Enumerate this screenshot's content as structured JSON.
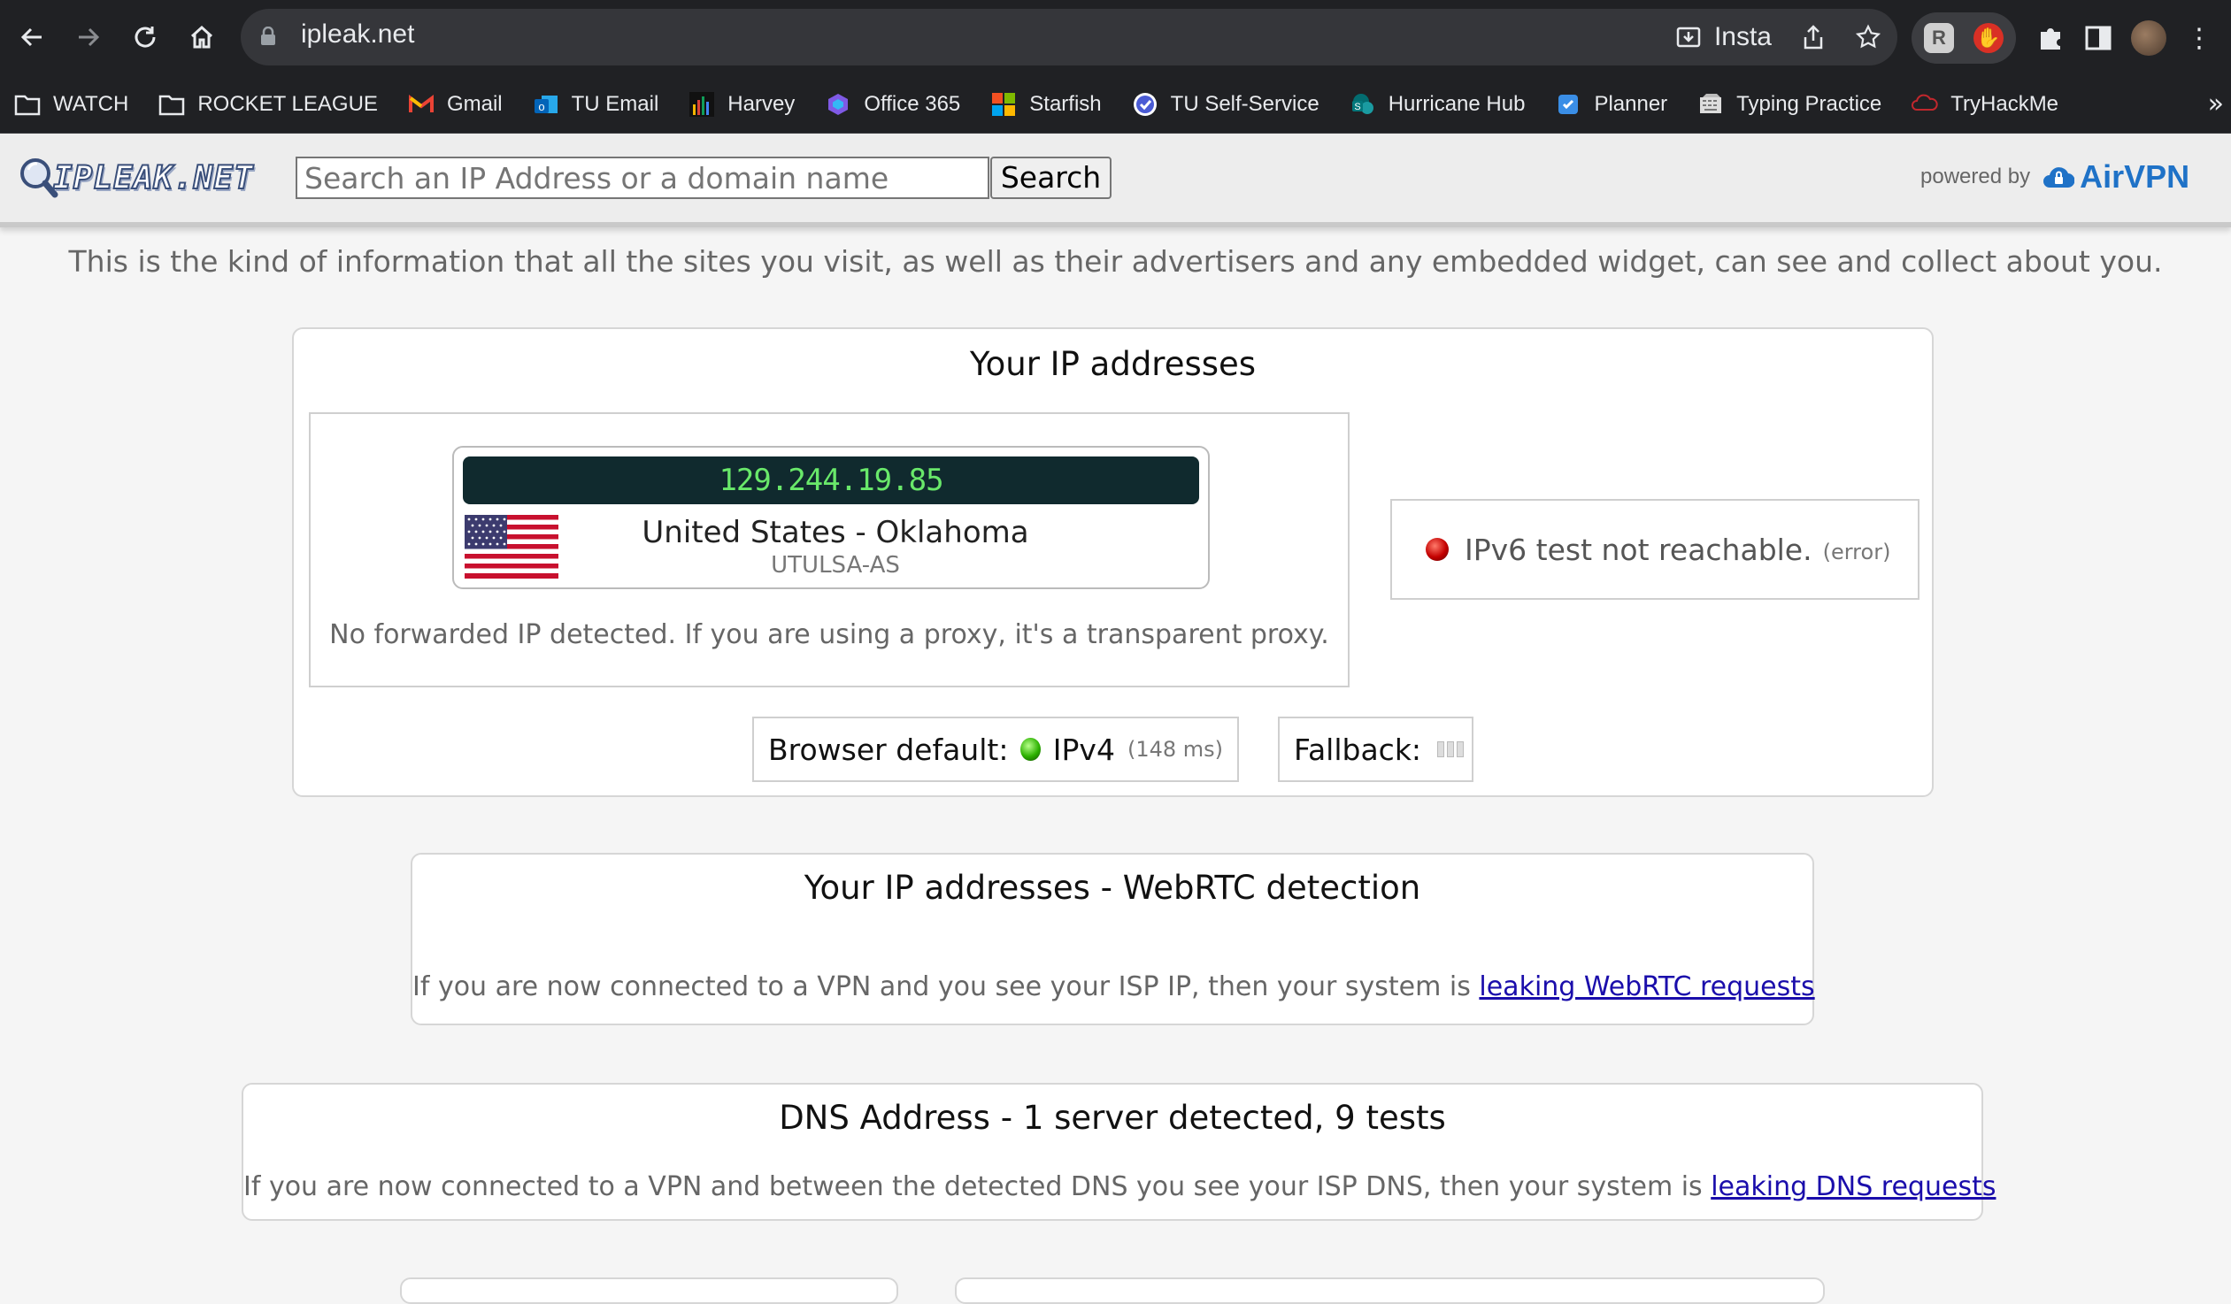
{
  "browser": {
    "url": "ipleak.net",
    "install_label": "Insta",
    "bookmarks": [
      {
        "label": "WATCH",
        "icon": "folder-icon"
      },
      {
        "label": "ROCKET LEAGUE",
        "icon": "folder-icon"
      },
      {
        "label": "Gmail",
        "icon": "gmail-icon"
      },
      {
        "label": "TU Email",
        "icon": "outlook-icon"
      },
      {
        "label": "Harvey",
        "icon": "harvey-icon"
      },
      {
        "label": "Office 365",
        "icon": "office-icon"
      },
      {
        "label": "Starfish",
        "icon": "starfish-icon"
      },
      {
        "label": "TU Self-Service",
        "icon": "self-service-icon"
      },
      {
        "label": "Hurricane Hub",
        "icon": "sharepoint-icon"
      },
      {
        "label": "Planner",
        "icon": "planner-icon"
      },
      {
        "label": "Typing Practice",
        "icon": "typing-icon"
      },
      {
        "label": "TryHackMe",
        "icon": "tryhackme-icon"
      }
    ],
    "more_label": "»"
  },
  "header": {
    "logo_text": "IPLEAK.NET",
    "search_placeholder": "Search an IP Address or a domain name",
    "search_button": "Search",
    "powered_by": "powered by",
    "airvpn": "AirVPN"
  },
  "intro": "This is the kind of information that all the sites you visit, as well as their advertisers and any embedded widget, can see and collect about you.",
  "ip_card": {
    "title": "Your IP addresses",
    "ip": "129.244.19.85",
    "country": "United States - Oklahoma",
    "isp": "UTULSA-AS",
    "forwarded_note": "No forwarded IP detected. If you are using a proxy, it's a transparent proxy.",
    "ipv6_text": "IPv6 test not reachable.",
    "ipv6_note": "(error)",
    "browser_default_label": "Browser default:",
    "browser_default_value": "IPv4",
    "browser_default_ms": "(148 ms)",
    "fallback_label": "Fallback:"
  },
  "webrtc_card": {
    "title": "Your IP addresses - WebRTC detection",
    "note": "If you are now connected to a VPN and you see your ISP IP, then your system is ",
    "link": "leaking WebRTC requests"
  },
  "dns_card": {
    "title": "DNS Address - 1 server detected, 9 tests",
    "note": "If you are now connected to a VPN and between the detected DNS you see your ISP DNS, then your system is ",
    "link": "leaking DNS requests"
  },
  "colors": {
    "chrome_bg": "#202124",
    "omnibox_bg": "#35363a",
    "ip_display_bg": "#102a2e",
    "ip_display_text": "#69e86a",
    "link": "#1a0dab",
    "airvpn_blue": "#1f72c7"
  }
}
